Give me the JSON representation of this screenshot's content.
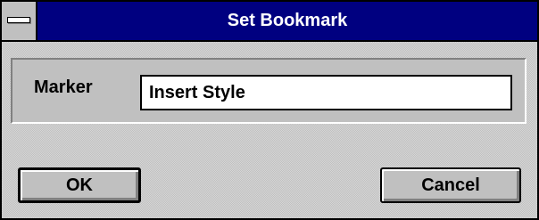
{
  "dialog": {
    "title": "Set Bookmark",
    "marker_label": "Marker",
    "marker_value": "Insert Style",
    "ok_label": "OK",
    "cancel_label": "Cancel"
  },
  "icons": {
    "system_menu": "system-menu-icon"
  },
  "colors": {
    "titlebar": "#000080",
    "face": "#c0c0c0",
    "highlight": "#ffffff",
    "shadow": "#808080"
  }
}
